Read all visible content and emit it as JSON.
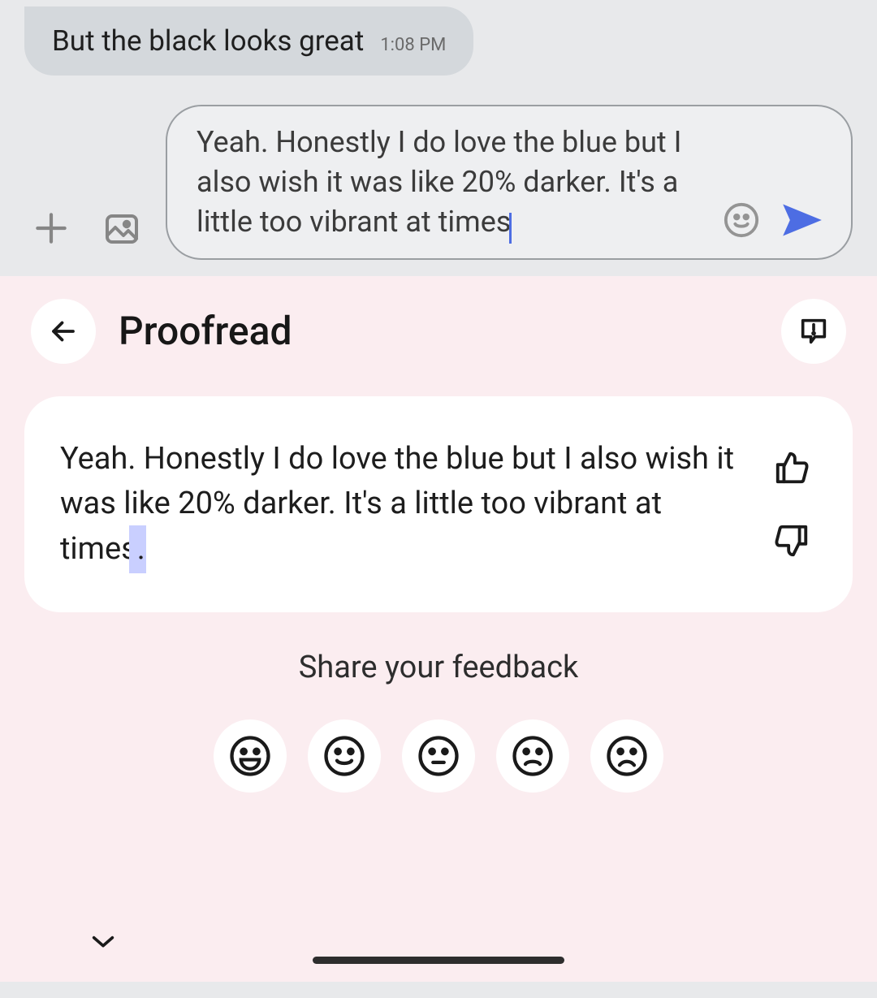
{
  "received": {
    "text": "But the black looks great",
    "time": "1:08 PM"
  },
  "compose": {
    "text": "Yeah. Honestly I do love the blue but I also wish it was like 20% darker. It's a little too vibrant at times"
  },
  "panel": {
    "title": "Proofread",
    "suggestion_main": "Yeah. Honestly I do love the blue but I also wish it was like 20% darker. It's a little too vibrant at times",
    "suggestion_edit": ".",
    "feedback_prompt": "Share your feedback"
  },
  "icons": {
    "plus": "plus",
    "gallery": "gallery",
    "emoji": "emoji",
    "send": "send",
    "back": "back",
    "report": "report",
    "thumbs_up": "thumbs_up",
    "thumbs_down": "thumbs_down",
    "chevron_down": "chevron_down"
  },
  "faces": [
    "very-happy",
    "happy",
    "neutral",
    "sad",
    "very-sad"
  ]
}
